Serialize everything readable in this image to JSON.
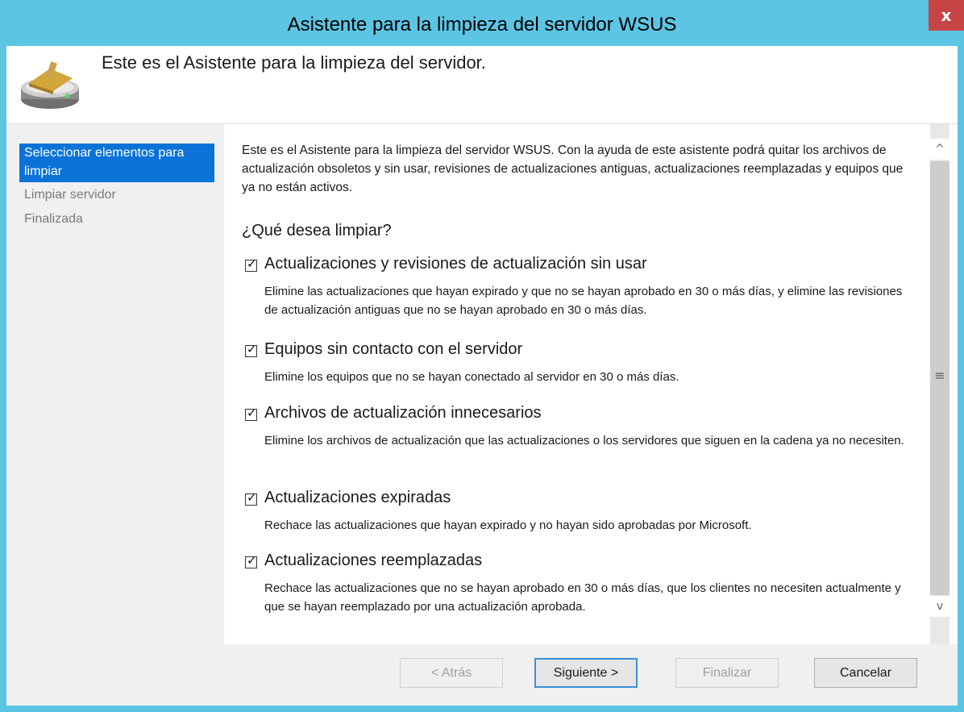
{
  "window": {
    "title": "Asistente para la limpieza del servidor WSUS",
    "close_label": "x"
  },
  "header": {
    "title": "Este es el Asistente para la limpieza del servidor."
  },
  "sidebar": {
    "steps": [
      {
        "label": "Seleccionar elementos para limpiar",
        "active": true
      },
      {
        "label": "Limpiar servidor",
        "active": false
      },
      {
        "label": "Finalizada",
        "active": false
      }
    ]
  },
  "main": {
    "intro": "Este es el Asistente para la limpieza del servidor WSUS. Con la ayuda de este asistente podrá quitar los archivos de actualización obsoletos y sin usar, revisiones de actualizaciones antiguas, actualizaciones reemplazadas y equipos que ya no están activos.",
    "question": "¿Qué desea limpiar?",
    "options": [
      {
        "label": "Actualizaciones y revisiones de actualización sin usar",
        "checked": true,
        "description": "Elimine las actualizaciones que hayan expirado y que no se hayan aprobado en 30 o más días, y elimine las revisiones de actualización antiguas que no se hayan aprobado en 30 o más días."
      },
      {
        "label": "Equipos sin contacto con el servidor",
        "checked": true,
        "description": "Elimine los equipos que no se hayan conectado al servidor en 30 o más días."
      },
      {
        "label": "Archivos de actualización innecesarios",
        "checked": true,
        "description": "Elimine los archivos de actualización que las actualizaciones o los servidores que siguen en la cadena ya no necesiten."
      },
      {
        "label": "Actualizaciones expiradas",
        "checked": true,
        "description": "Rechace las actualizaciones que hayan expirado y no hayan sido aprobadas por Microsoft."
      },
      {
        "label": "Actualizaciones reemplazadas",
        "checked": true,
        "description": "Rechace las actualizaciones que no se hayan aprobado en 30 o más días, que los clientes no necesiten actualmente y que se hayan reemplazado por una actualización aprobada."
      }
    ],
    "check_glyph": "✓"
  },
  "scrollbar": {
    "up_glyph": "^",
    "down_glyph": "v",
    "grip_glyph": "≡"
  },
  "buttons": {
    "back": "< Atrás",
    "next": "Siguiente >",
    "finish": "Finalizar",
    "cancel": "Cancelar"
  },
  "colors": {
    "titlebar": "#5cc5e4",
    "close_button": "#c84343",
    "active_step": "#0b73d8",
    "default_button_border": "#3c8fd8"
  },
  "icons": {
    "header_icon": "server-cleanup-icon"
  }
}
